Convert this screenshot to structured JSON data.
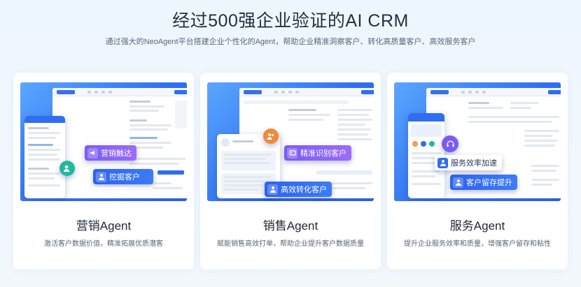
{
  "header": {
    "title": "经过500强企业验证的AI CRM",
    "subtitle": "通过强大的NeoAgent平台搭建企业个性化的Agent，帮助企业精准洞察客户、转化高质量客户、高效服务客户"
  },
  "cards": [
    {
      "title": "营销Agent",
      "desc": "激活客户数据价值，精准拓展优质潜客",
      "tags": [
        "营销触达",
        "挖掘客户"
      ]
    },
    {
      "title": "销售Agent",
      "desc": "赋能销售高效打单，帮助企业提升客户数据质量",
      "tags": [
        "精准识别客户",
        "高效转化客户"
      ]
    },
    {
      "title": "服务Agent",
      "desc": "提升企业服务效率和质量，增强客户留存和粘性",
      "tags": [
        "服务效率加速",
        "客户留存提升"
      ]
    }
  ],
  "colors": {
    "brand_blue": "#2f6ef0",
    "accent_purple": "#7a5cf5",
    "page_bg": "#eef6fd"
  },
  "icons": {
    "marketing_touch": "megaphone-icon",
    "mining": "user-search-icon",
    "identify": "id-card-icon",
    "convert": "user-convert-icon",
    "service": "headset-icon",
    "retention": "user-heart-icon"
  }
}
